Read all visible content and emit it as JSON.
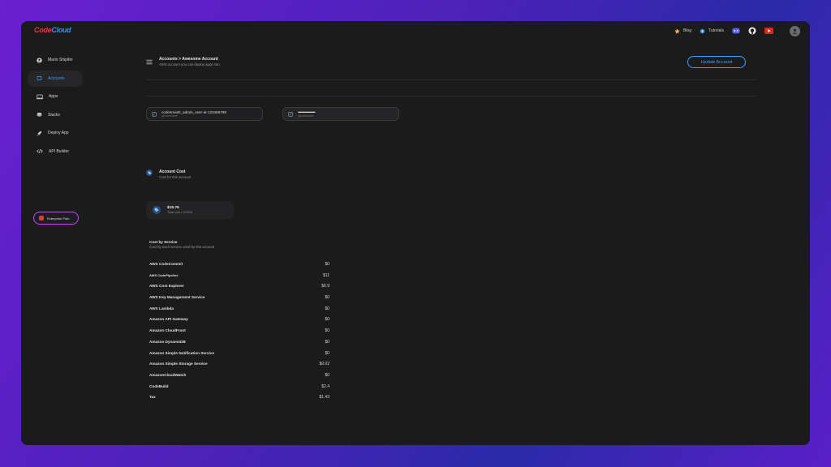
{
  "app": {
    "logo_part1": "Code",
    "logo_part2": "Cloud"
  },
  "topnav": {
    "blog": "Blog",
    "tutorials": "Tutorials"
  },
  "sidebar": {
    "items": [
      {
        "label": "Mario Shipifer",
        "icon": "user-icon"
      },
      {
        "label": "Accounts",
        "icon": "accounts-icon",
        "active": true
      },
      {
        "label": "Apps",
        "icon": "apps-icon"
      },
      {
        "label": "Stacks",
        "icon": "stacks-icon"
      },
      {
        "label": "Deploy App",
        "icon": "rocket-icon"
      },
      {
        "label": "API Builder",
        "icon": "code-icon"
      }
    ],
    "enterprise_label": "Enterprise Plan"
  },
  "header": {
    "breadcrumb": "Accounts > Awesome Account",
    "subtitle": "AWS account you can deploy apps into",
    "update_button": "Update Account"
  },
  "fields": {
    "username_value": "codesmash_admin_user-at-123456789",
    "username_hint": "git username",
    "password_value": "••••••••••••••••••••••••••••••••••",
    "password_hint": "git password"
  },
  "account_cost": {
    "title": "Account Cost",
    "subtitle": "Cost for this account",
    "total_value": "$15.76",
    "total_label": "Total cost",
    "period": "6/2024"
  },
  "cost_by_service": {
    "title": "Cost by Service",
    "subtitle": "Cost by each service used by this account",
    "rows": [
      {
        "service": "AWS CodeCommit",
        "cost": "$0"
      },
      {
        "service": "AWS CodePipeline",
        "cost": "$11"
      },
      {
        "service": "AWS Cost Explorer",
        "cost": "$0.9"
      },
      {
        "service": "AWS Key Management Service",
        "cost": "$0"
      },
      {
        "service": "AWS Lambda",
        "cost": "$0"
      },
      {
        "service": "Amazon API Gateway",
        "cost": "$0"
      },
      {
        "service": "Amazon CloudFront",
        "cost": "$0"
      },
      {
        "service": "Amazon DynamoDB",
        "cost": "$0"
      },
      {
        "service": "Amazon Simple Notification Service",
        "cost": "$0"
      },
      {
        "service": "Amazon Simple Storage Service",
        "cost": "$0.02"
      },
      {
        "service": "AmazonCloudWatch",
        "cost": "$0"
      },
      {
        "service": "CodeBuild",
        "cost": "$2.4"
      },
      {
        "service": "Tax",
        "cost": "$1.43"
      }
    ]
  },
  "colors": {
    "accent": "#3aa0ff",
    "enterprise_border": "#c04bff",
    "brand_red": "#e23a3a"
  }
}
